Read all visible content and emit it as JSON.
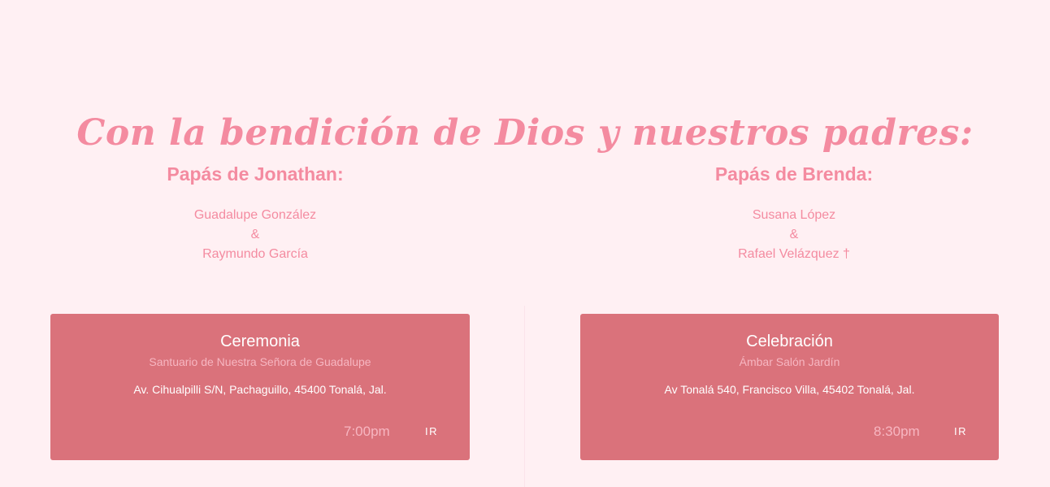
{
  "heading": "Con la bendición de Dios y nuestros padres:",
  "groom_parents": {
    "title": "Papás de Jonathan:",
    "name1": "Guadalupe González",
    "separator": "&",
    "name2": "Raymundo García"
  },
  "bride_parents": {
    "title": "Papás de Brenda:",
    "name1": "Susana López",
    "separator": "&",
    "name2": "Rafael Velázquez †"
  },
  "events": [
    {
      "title": "Ceremonia",
      "venue": "Santuario de Nuestra Señora de Guadalupe",
      "address": "Av. Cihualpilli S/N, Pachaguillo, 45400 Tonalá, Jal.",
      "time": "7:00pm",
      "button": "IR"
    },
    {
      "title": "Celebración",
      "venue": "Ámbar Salón Jardín",
      "address": "Av Tonalá 540, Francisco Villa, 45402 Tonalá, Jal.",
      "time": "8:30pm",
      "button": "IR"
    }
  ],
  "colors": {
    "background": "#fff0f3",
    "accent_pink": "#f48ba0",
    "card": "#da727b",
    "card_muted_text": "#f7b6c1"
  }
}
